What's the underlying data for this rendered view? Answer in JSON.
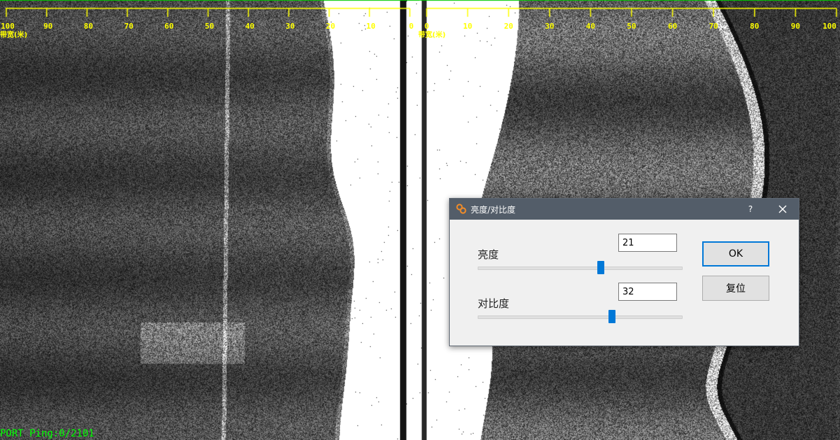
{
  "sonar_view": {
    "port_scale_labels": [
      "100",
      "90",
      "80",
      "70",
      "60",
      "50",
      "40",
      "30",
      "20",
      "10",
      "0"
    ],
    "starboard_scale_labels": [
      "0",
      "10",
      "20",
      "30",
      "40",
      "50",
      "60",
      "70",
      "80",
      "90",
      "100"
    ],
    "port_unit_label": "带宽(米)",
    "starboard_unit_label": "带宽(米)",
    "scale_color": "#ffff00",
    "status_text": "PORT Ping:0/2101",
    "status_color": "#00ff00"
  },
  "dialog": {
    "title": "亮度/对比度",
    "help_label": "?",
    "brightness": {
      "label": "亮度",
      "value": "21",
      "slider_fraction": 0.6
    },
    "contrast": {
      "label": "对比度",
      "value": "32",
      "slider_fraction": 0.655
    },
    "ok_label": "OK",
    "reset_label": "复位",
    "accent_color": "#0078d7",
    "titlebar_color": "#535d69"
  }
}
